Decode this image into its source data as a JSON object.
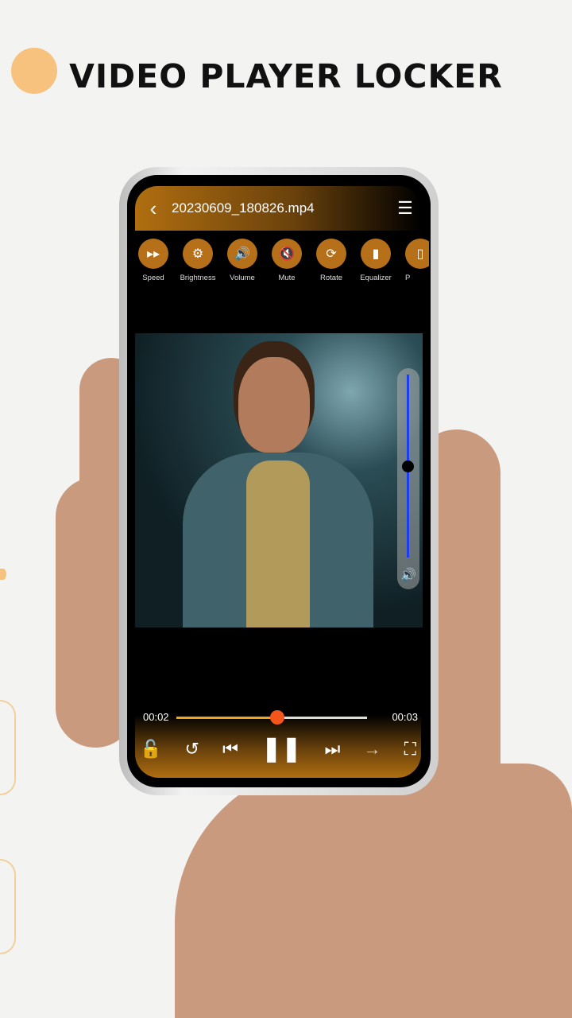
{
  "headline": "VIDEO PLAYER LOCKER",
  "player": {
    "file_name": "20230609_180826.mp4",
    "back_icon": "chevron-left-icon",
    "playlist_icon": "playlist-icon",
    "tools": [
      {
        "label": "Speed",
        "icon": "fast-forward-icon",
        "glyph": "▸▸"
      },
      {
        "label": "Brightness",
        "icon": "brightness-icon",
        "glyph": "⚙"
      },
      {
        "label": "Volume",
        "icon": "volume-icon",
        "glyph": "🔊"
      },
      {
        "label": "Mute",
        "icon": "mute-icon",
        "glyph": "🔇"
      },
      {
        "label": "Rotate",
        "icon": "rotate-icon",
        "glyph": "⟳"
      },
      {
        "label": "Equalizer",
        "icon": "equalizer-icon",
        "glyph": "▮"
      },
      {
        "label": "P",
        "icon": "popup-icon",
        "glyph": "▯"
      }
    ],
    "volume_level": 0.5,
    "current_time": "00:02",
    "duration": "00:03",
    "progress": 0.53,
    "colors": {
      "accent": "#b7701a",
      "progress": "#f0a520",
      "knob": "#f4551a",
      "volume": "#1d3df0"
    }
  }
}
